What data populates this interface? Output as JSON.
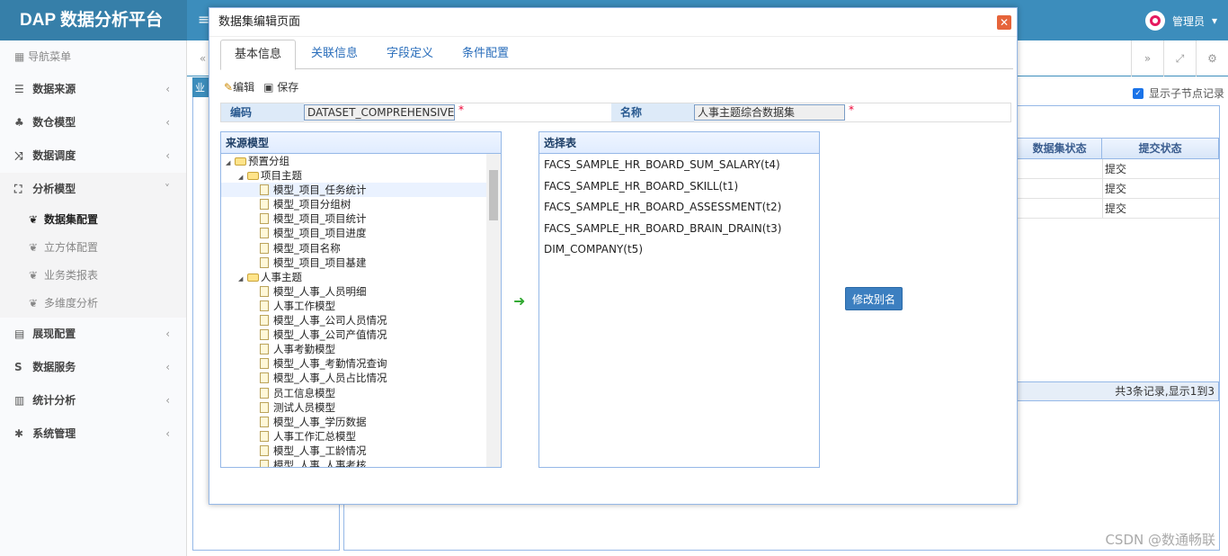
{
  "app": {
    "title": "DAP 数据分析平台",
    "user": "管理员"
  },
  "sidebar": {
    "header": "导航菜单",
    "items": [
      {
        "label": "数据来源",
        "icon": "database-icon"
      },
      {
        "label": "数仓模型",
        "icon": "cubes-icon"
      },
      {
        "label": "数据调度",
        "icon": "random-icon"
      },
      {
        "label": "分析模型",
        "icon": "model-icon"
      },
      {
        "label": "展现配置",
        "icon": "film-icon"
      },
      {
        "label": "数据服务",
        "icon": "s-icon"
      },
      {
        "label": "统计分析",
        "icon": "bar-chart-icon"
      },
      {
        "label": "系统管理",
        "icon": "gear-icon"
      }
    ],
    "subitems": [
      "数据集配置",
      "立方体配置",
      "业务类报表",
      "多维度分析"
    ]
  },
  "background": {
    "tab_label": "业",
    "show_child_label": "显示子节点记录",
    "columns": [
      "数据集状态",
      "提交状态"
    ],
    "rows": [
      {
        "status": "",
        "submit": "提交"
      },
      {
        "status": "",
        "submit": "提交"
      },
      {
        "status": "",
        "submit": "提交"
      }
    ],
    "footer": "共3条记录,显示1到3"
  },
  "dialog": {
    "title": "数据集编辑页面",
    "tabs": [
      "基本信息",
      "关联信息",
      "字段定义",
      "条件配置"
    ],
    "edit_label": "编辑",
    "save_label": "保存",
    "form": {
      "code_label": "编码",
      "code_value": "DATASET_COMPREHENSIVE",
      "name_label": "名称",
      "name_value": "人事主题综合数据集",
      "required": "*"
    },
    "source": {
      "title": "来源模型",
      "tree": [
        {
          "label": "预置分组",
          "level": 0,
          "type": "folder"
        },
        {
          "label": "项目主题",
          "level": 1,
          "type": "folder"
        },
        {
          "label": "模型_项目_任务统计",
          "level": 2,
          "type": "file",
          "selected": true
        },
        {
          "label": "模型_项目分组树",
          "level": 2,
          "type": "file"
        },
        {
          "label": "模型_项目_项目统计",
          "level": 2,
          "type": "file"
        },
        {
          "label": "模型_项目_项目进度",
          "level": 2,
          "type": "file"
        },
        {
          "label": "模型_项目名称",
          "level": 2,
          "type": "file"
        },
        {
          "label": "模型_项目_项目基建",
          "level": 2,
          "type": "file"
        },
        {
          "label": "人事主题",
          "level": 1,
          "type": "folder"
        },
        {
          "label": "模型_人事_人员明细",
          "level": 2,
          "type": "file"
        },
        {
          "label": "人事工作模型",
          "level": 2,
          "type": "file"
        },
        {
          "label": "模型_人事_公司人员情况",
          "level": 2,
          "type": "file"
        },
        {
          "label": "模型_人事_公司产值情况",
          "level": 2,
          "type": "file"
        },
        {
          "label": "人事考勤模型",
          "level": 2,
          "type": "file"
        },
        {
          "label": "模型_人事_考勤情况查询",
          "level": 2,
          "type": "file"
        },
        {
          "label": "模型_人事_人员占比情况",
          "level": 2,
          "type": "file"
        },
        {
          "label": "员工信息模型",
          "level": 2,
          "type": "file"
        },
        {
          "label": "测试人员模型",
          "level": 2,
          "type": "file"
        },
        {
          "label": "模型_人事_学历数据",
          "level": 2,
          "type": "file"
        },
        {
          "label": "人事工作汇总模型",
          "level": 2,
          "type": "file"
        },
        {
          "label": "模型_人事_工龄情况",
          "level": 2,
          "type": "file"
        },
        {
          "label": "模型_人事_人事考核",
          "level": 2,
          "type": "file"
        }
      ]
    },
    "selected": {
      "title": "选择表",
      "items": [
        "FACS_SAMPLE_HR_BOARD_SUM_SALARY(t4)",
        "FACS_SAMPLE_HR_BOARD_SKILL(t1)",
        "FACS_SAMPLE_HR_BOARD_ASSESSMENT(t2)",
        "FACS_SAMPLE_HR_BOARD_BRAIN_DRAIN(t3)",
        "DIM_COMPANY(t5)"
      ]
    },
    "rename_label": "修改别名"
  },
  "watermark": "CSDN @数通畅联"
}
